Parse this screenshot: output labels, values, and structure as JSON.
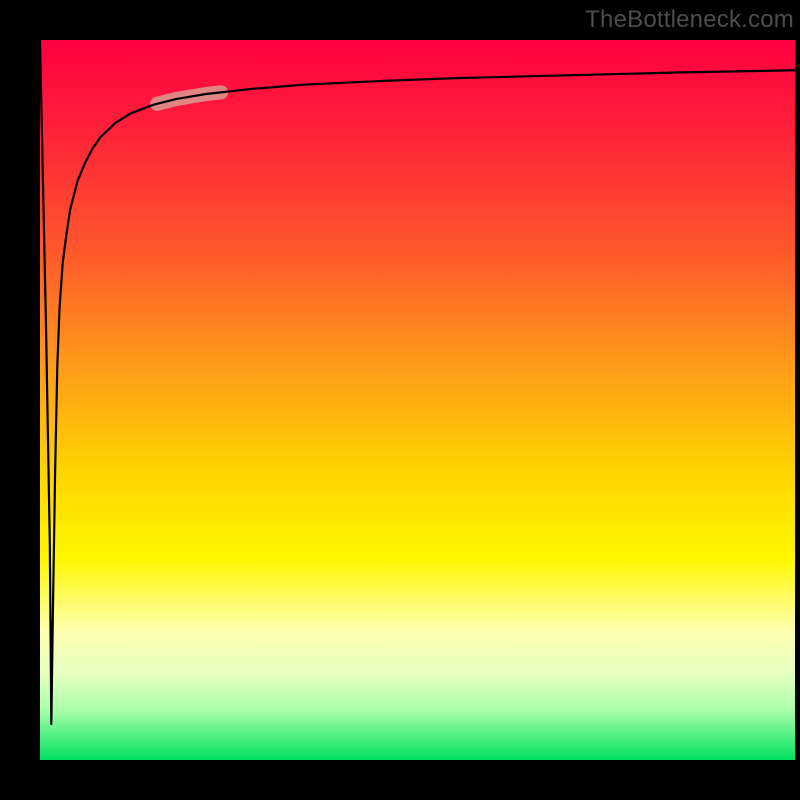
{
  "watermark": "TheBottleneck.com",
  "chart_data": {
    "type": "line",
    "title": "",
    "xlabel": "",
    "ylabel": "",
    "xlim": [
      0,
      100
    ],
    "ylim": [
      0,
      100
    ],
    "grid": false,
    "legend": false,
    "background": {
      "type": "vertical-gradient",
      "stops": [
        {
          "pos": 0.0,
          "color": "#ff0040"
        },
        {
          "pos": 0.12,
          "color": "#ff1f3a"
        },
        {
          "pos": 0.3,
          "color": "#ff5a2a"
        },
        {
          "pos": 0.45,
          "color": "#ff9a1a"
        },
        {
          "pos": 0.6,
          "color": "#ffd400"
        },
        {
          "pos": 0.72,
          "color": "#fff700"
        },
        {
          "pos": 0.82,
          "color": "#fdffb0"
        },
        {
          "pos": 0.88,
          "color": "#e8ffc0"
        },
        {
          "pos": 0.93,
          "color": "#aaffaa"
        },
        {
          "pos": 1.0,
          "color": "#00e060"
        }
      ]
    },
    "series": [
      {
        "name": "bottleneck-curve",
        "color": "#000000",
        "stroke_width": 2,
        "x": [
          0.0,
          0.8,
          1.3,
          1.5,
          1.7,
          2.0,
          2.3,
          2.6,
          3.0,
          3.5,
          4.0,
          5.0,
          6.0,
          7.0,
          8.0,
          10.0,
          12.0,
          15.0,
          18.0,
          22.0,
          28.0,
          35.0,
          45.0,
          55.0,
          70.0,
          85.0,
          100.0
        ],
        "y": [
          100.0,
          60.0,
          30.0,
          5.0,
          20.0,
          40.0,
          55.0,
          63.0,
          69.0,
          73.0,
          76.5,
          80.5,
          83.0,
          85.0,
          86.5,
          88.5,
          89.8,
          91.0,
          91.8,
          92.5,
          93.2,
          93.8,
          94.3,
          94.7,
          95.1,
          95.5,
          95.8
        ]
      }
    ],
    "annotations": [
      {
        "name": "highlight-segment",
        "type": "stroke-highlight",
        "color": "#d99a8f",
        "opacity": 0.85,
        "stroke_width": 14,
        "x_range": [
          15.5,
          24.0
        ],
        "y_range": [
          84.0,
          88.0
        ]
      }
    ]
  }
}
